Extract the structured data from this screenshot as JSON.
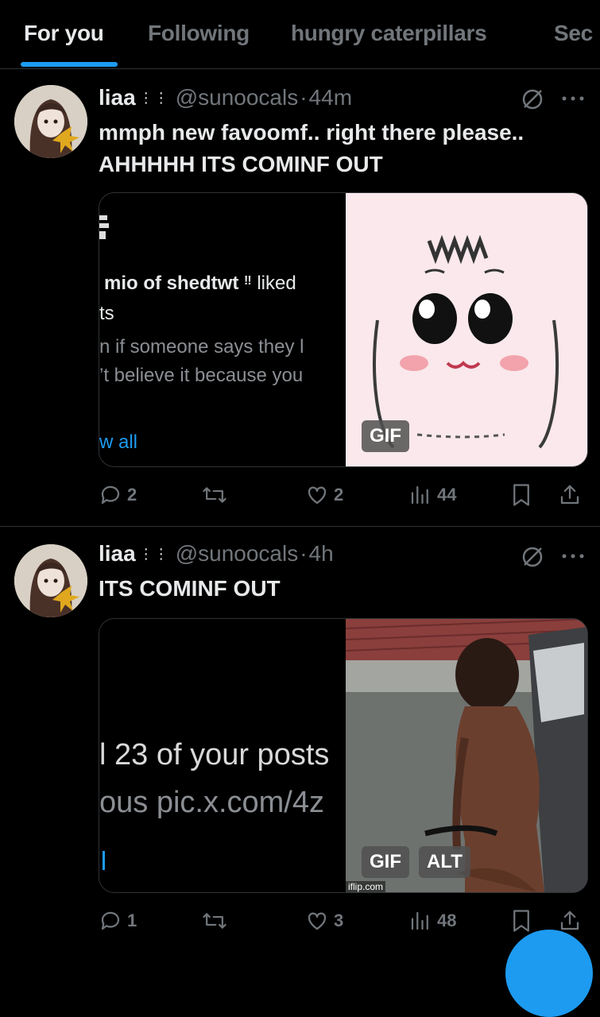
{
  "tabs": [
    "For you",
    "Following",
    "hungry caterpillars",
    "Sec"
  ],
  "tweets": [
    {
      "name": "liaa",
      "badge": "⋮⋮",
      "handle": "@sunoocals",
      "dot": "·",
      "time": "44m",
      "text": "mmph new favoomf.. right there please.. AHHHHH ITS COMINF OUT",
      "quoted": {
        "line1_bold": "mio of shedtwt",
        "line1_mark": "‼",
        "line1_rest": "liked",
        "line2": "ts",
        "line3": "n if someone says they l",
        "line4": "’t believe it because you",
        "link": "w all"
      },
      "gif_label": "GIF",
      "replies": "2",
      "reposts": "",
      "likes": "2",
      "views": "44"
    },
    {
      "name": "liaa",
      "badge": "⋮⋮",
      "handle": "@sunoocals",
      "dot": "·",
      "time": "4h",
      "text": "ITS COMINF OUT",
      "quoted": {
        "line1": "l 23 of your posts",
        "line2": "ous pic.x.com/4z"
      },
      "gif_label": "GIF",
      "alt_label": "ALT",
      "watermark": "iflip.com",
      "replies": "1",
      "reposts": "",
      "likes": "3",
      "views": "48"
    }
  ],
  "colors": {
    "accent": "#1d9bf0",
    "muted": "#71767b",
    "text": "#e7e9ea",
    "divider": "#2f3336"
  }
}
